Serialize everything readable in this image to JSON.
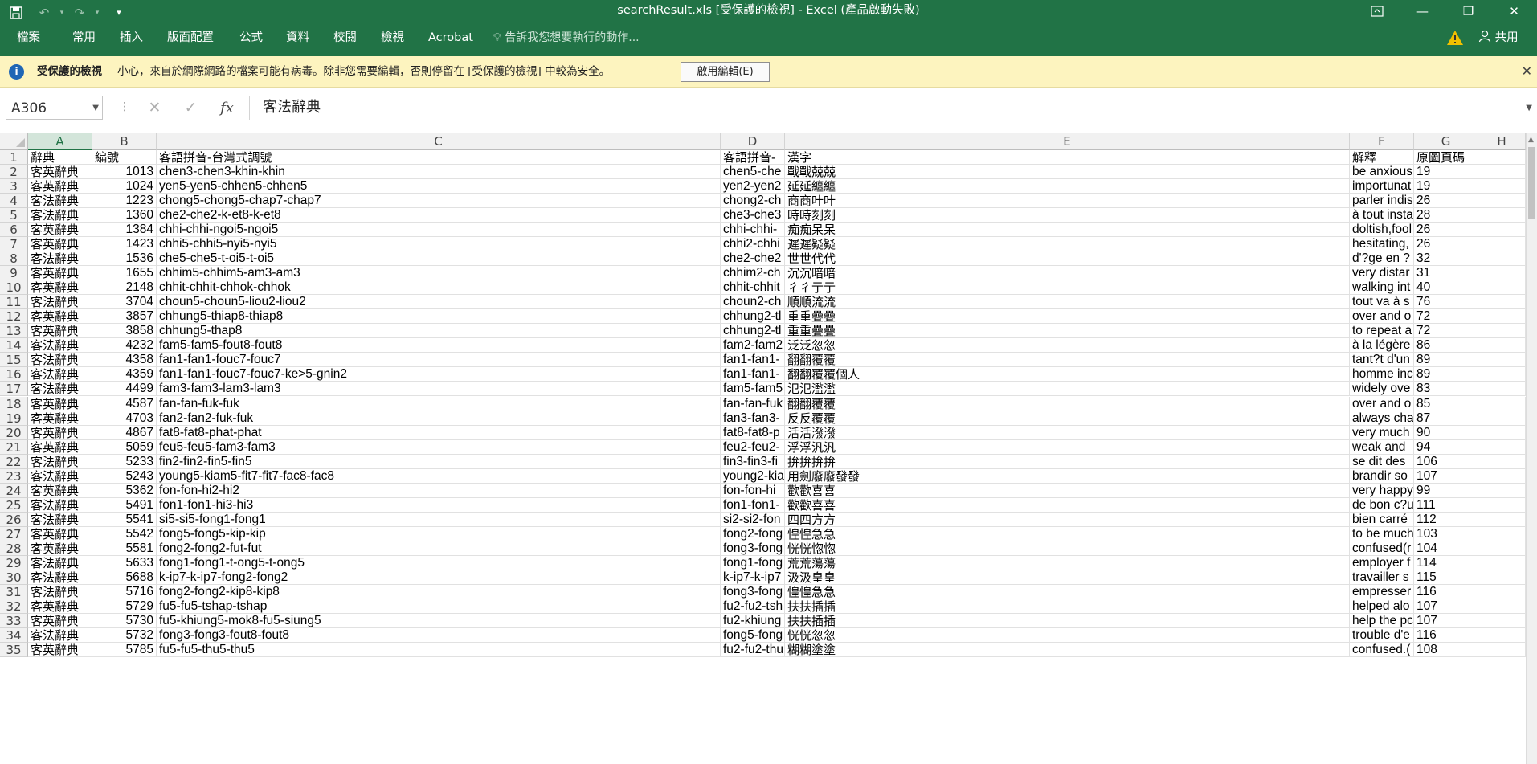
{
  "window": {
    "title": "searchResult.xls  [受保護的檢視] - Excel (產品啟動失敗)"
  },
  "qat": {
    "save_icon": "save-icon",
    "undo_icon": "undo-icon",
    "redo_icon": "redo-icon",
    "customize_icon": "customize-qat-icon"
  },
  "ribbon": {
    "tabs": [
      "檔案",
      "常用",
      "插入",
      "版面配置",
      "公式",
      "資料",
      "校閱",
      "檢視",
      "Acrobat"
    ],
    "tell_me": "告訴我您想要執行的動作...",
    "share": "共用"
  },
  "protected_bar": {
    "title": "受保護的檢視",
    "message": "小心，來自於網際網路的檔案可能有病毒。除非您需要編輯，否則停留在 [受保護的檢視] 中較為安全。",
    "enable_button": "啟用編輯(E)"
  },
  "formula_bar": {
    "name_box": "A306",
    "formula": "客法辭典"
  },
  "columns": [
    "A",
    "B",
    "C",
    "D",
    "E",
    "F",
    "G",
    "H"
  ],
  "row_numbers": [
    "1",
    "2",
    "3",
    "4",
    "5",
    "6",
    "7",
    "8",
    "9",
    "10",
    "11",
    "12",
    "13",
    "14",
    "15",
    "16",
    "17",
    "18",
    "19",
    "20",
    "21",
    "22",
    "23",
    "24",
    "25",
    "26",
    "27",
    "28",
    "29",
    "30",
    "31",
    "32",
    "33",
    "34",
    "35"
  ],
  "rows": [
    [
      "辭典",
      "編號",
      "客語拼音-台灣式調號",
      "客語拼音-",
      "漢字",
      "解釋",
      "原圖頁碼"
    ],
    [
      "客英辭典",
      "1013",
      "chen3-chen3-khin-khin",
      "chen5-che",
      "戰戰兢兢",
      "be anxious",
      "19"
    ],
    [
      "客英辭典",
      "1024",
      "yen5-yen5-chhen5-chhen5",
      "yen2-yen2",
      "延延纏纏",
      "importunat",
      "19"
    ],
    [
      "客法辭典",
      "1223",
      "chong5-chong5-chap7-chap7",
      "chong2-ch",
      "商商叶叶",
      "parler indis",
      "26"
    ],
    [
      "客法辭典",
      "1360",
      "che2-che2-k-et8-k-et8",
      "che3-che3",
      "時時刻刻",
      "à tout insta",
      "28"
    ],
    [
      "客英辭典",
      "1384",
      "chhi-chhi-ngoi5-ngoi5",
      "chhi-chhi-",
      "痴痴呆呆",
      "doltish,fool",
      "26"
    ],
    [
      "客英辭典",
      "1423",
      "chhi5-chhi5-nyi5-nyi5",
      "chhi2-chhi",
      "遲遲疑疑",
      "hesitating,",
      "26"
    ],
    [
      "客法辭典",
      "1536",
      "che5-che5-t-oi5-t-oi5",
      "che2-che2",
      "世世代代",
      "d'?ge en ?",
      "32"
    ],
    [
      "客英辭典",
      "1655",
      "chhim5-chhim5-am3-am3",
      "chhim2-ch",
      "沉沉暗暗",
      "very distar",
      "31"
    ],
    [
      "客英辭典",
      "2148",
      "chhit-chhit-chhok-chhok",
      "chhit-chhit",
      "彳彳亍亍",
      "walking int",
      "40"
    ],
    [
      "客法辭典",
      "3704",
      "choun5-choun5-liou2-liou2",
      "choun2-ch",
      "順順流流",
      "tout va à s",
      "76"
    ],
    [
      "客英辭典",
      "3857",
      "chhung5-thiap8-thiap8",
      "chhung2-tl",
      "重重疊疊",
      "over and o",
      "72"
    ],
    [
      "客英辭典",
      "3858",
      "chhung5-thap8",
      "chhung2-tl",
      "重重疊疊",
      "to repeat a",
      "72"
    ],
    [
      "客法辭典",
      "4232",
      "fam5-fam5-fout8-fout8",
      "fam2-fam2",
      "泛泛忽忽",
      "à la légère",
      "86"
    ],
    [
      "客法辭典",
      "4358",
      "fan1-fan1-fouc7-fouc7",
      "fan1-fan1-",
      "翻翻覆覆",
      "tant?t d'un",
      "89"
    ],
    [
      "客法辭典",
      "4359",
      "fan1-fan1-fouc7-fouc7-ke>5-gnin2",
      "fan1-fan1-",
      "翻翻覆覆個人",
      "homme inc",
      "89"
    ],
    [
      "客法辭典",
      "4499",
      "fam3-fam3-lam3-lam3",
      "fam5-fam5",
      "氾氾濫濫",
      "widely ove",
      "83"
    ],
    [
      "客英辭典",
      "4587",
      "fan-fan-fuk-fuk",
      "fan-fan-fuk",
      "翻翻覆覆",
      "over and o",
      "85"
    ],
    [
      "客英辭典",
      "4703",
      "fan2-fan2-fuk-fuk",
      "fan3-fan3-",
      "反反覆覆",
      "always cha",
      "87"
    ],
    [
      "客英辭典",
      "4867",
      "fat8-fat8-phat-phat",
      "fat8-fat8-p",
      "活活潑潑",
      "very much",
      "90"
    ],
    [
      "客英辭典",
      "5059",
      "feu5-feu5-fam3-fam3",
      "feu2-feu2-",
      "浮浮汎汎",
      "weak and",
      "94"
    ],
    [
      "客法辭典",
      "5233",
      "fin2-fin2-fin5-fin5",
      "fin3-fin3-fi",
      "拚拚拚拚",
      "se dit des",
      "106"
    ],
    [
      "客法辭典",
      "5243",
      "young5-kiam5-fit7-fit7-fac8-fac8",
      "young2-kia",
      "用劍廢廢發發",
      "brandir so",
      "107"
    ],
    [
      "客英辭典",
      "5362",
      "fon-fon-hi2-hi2",
      "fon-fon-hi",
      "歡歡喜喜",
      "very happy",
      "99"
    ],
    [
      "客法辭典",
      "5491",
      "fon1-fon1-hi3-hi3",
      "fon1-fon1-",
      "歡歡喜喜",
      "de bon c?u",
      "111"
    ],
    [
      "客法辭典",
      "5541",
      "si5-si5-fong1-fong1",
      "si2-si2-fon",
      "四四方方",
      "bien carré",
      "112"
    ],
    [
      "客英辭典",
      "5542",
      "fong5-fong5-kip-kip",
      "fong2-fong",
      "惶惶急急",
      "to be much",
      "103"
    ],
    [
      "客英辭典",
      "5581",
      "fong2-fong2-fut-fut",
      "fong3-fong",
      "恍恍惚惚",
      "confused(r",
      "104"
    ],
    [
      "客法辭典",
      "5633",
      "fong1-fong1-t-ong5-t-ong5",
      "fong1-fong",
      "荒荒蕩蕩",
      "employer f",
      "114"
    ],
    [
      "客法辭典",
      "5688",
      "k-ip7-k-ip7-fong2-fong2",
      "k-ip7-k-ip7",
      "汲汲皇皇",
      "travailler s",
      "115"
    ],
    [
      "客法辭典",
      "5716",
      "fong2-fong2-kip8-kip8",
      "fong3-fong",
      "惶惶急急",
      "empresser",
      "116"
    ],
    [
      "客英辭典",
      "5729",
      "fu5-fu5-tshap-tshap",
      "fu2-fu2-tsh",
      "扶扶插插",
      "helped alo",
      "107"
    ],
    [
      "客英辭典",
      "5730",
      "fu5-khiung5-mok8-fu5-siung5",
      "fu2-khiung",
      "扶扶插插",
      "help the pc",
      "107"
    ],
    [
      "客法辭典",
      "5732",
      "fong3-fong3-fout8-fout8",
      "fong5-fong",
      "恍恍忽忽",
      "trouble d'e",
      "116"
    ],
    [
      "客英辭典",
      "5785",
      "fu5-fu5-thu5-thu5",
      "fu2-fu2-thu",
      "糊糊塗塗",
      "confused.(",
      "108"
    ]
  ]
}
